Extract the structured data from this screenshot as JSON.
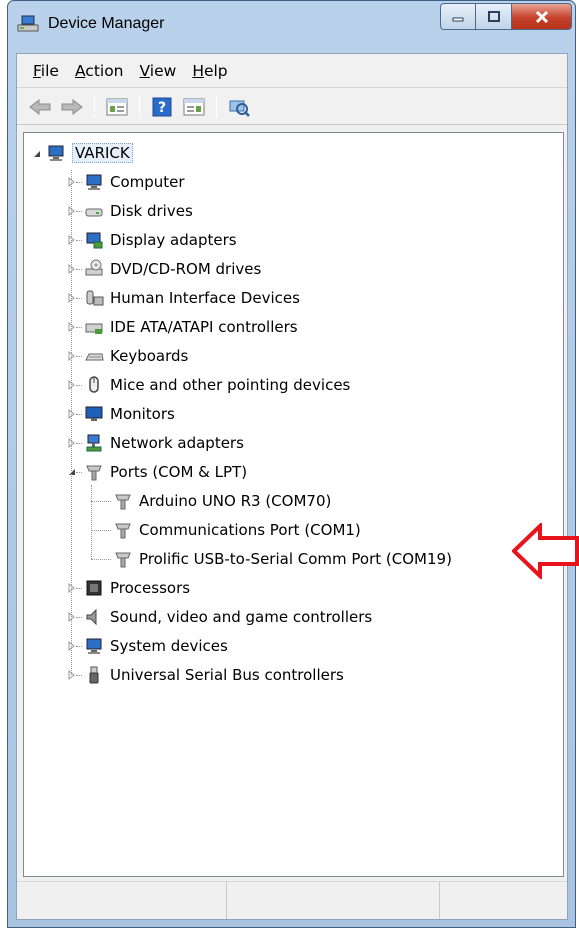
{
  "window": {
    "title": "Device Manager"
  },
  "menu": [
    {
      "label": "File",
      "accel": "F",
      "rest": "ile"
    },
    {
      "label": "Action",
      "accel": "A",
      "rest": "ction"
    },
    {
      "label": "View",
      "accel": "V",
      "rest": "iew"
    },
    {
      "label": "Help",
      "accel": "H",
      "rest": "elp"
    }
  ],
  "toolbar": [
    "back-icon",
    "forward-icon",
    "properties-icon",
    "help-icon",
    "update-driver-icon",
    "scan-hardware-icon"
  ],
  "tree": {
    "root": "VARICK",
    "categories": [
      {
        "label": "Computer",
        "icon": "computer-icon"
      },
      {
        "label": "Disk drives",
        "icon": "disk-drive-icon"
      },
      {
        "label": "Display adapters",
        "icon": "display-adapter-icon"
      },
      {
        "label": "DVD/CD-ROM drives",
        "icon": "dvd-drive-icon"
      },
      {
        "label": "Human Interface Devices",
        "icon": "hid-icon"
      },
      {
        "label": "IDE ATA/ATAPI controllers",
        "icon": "ide-controller-icon"
      },
      {
        "label": "Keyboards",
        "icon": "keyboard-icon"
      },
      {
        "label": "Mice and other pointing devices",
        "icon": "mouse-icon"
      },
      {
        "label": "Monitors",
        "icon": "monitor-icon"
      },
      {
        "label": "Network adapters",
        "icon": "network-adapter-icon"
      },
      {
        "label": "Ports (COM & LPT)",
        "icon": "port-icon",
        "expanded": true
      },
      {
        "label": "Processors",
        "icon": "processor-icon"
      },
      {
        "label": "Sound, video and game controllers",
        "icon": "sound-icon"
      },
      {
        "label": "System devices",
        "icon": "system-device-icon"
      },
      {
        "label": "Universal Serial Bus controllers",
        "icon": "usb-icon"
      }
    ],
    "ports": [
      "Arduino UNO R3 (COM70)",
      "Communications Port (COM1)",
      "Prolific USB-to-Serial Comm Port (COM19)"
    ]
  },
  "annotation": {
    "color": "#e8141b",
    "icon": "red-arrow-icon"
  }
}
